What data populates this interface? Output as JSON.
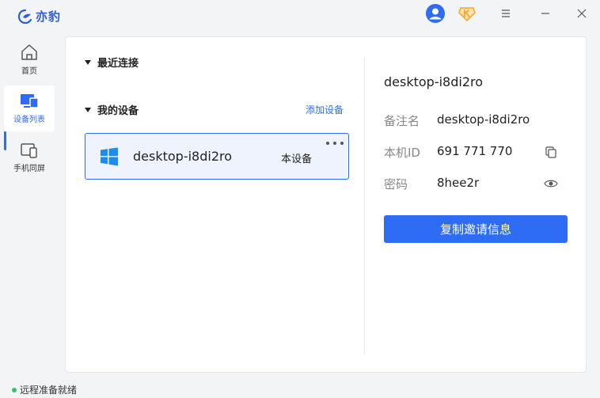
{
  "app": {
    "name": "亦豹"
  },
  "titlebar": {
    "icons": [
      "user-avatar-icon",
      "vip-badge-icon",
      "menu-icon",
      "minimize-icon",
      "close-icon"
    ]
  },
  "sidebar": {
    "items": [
      {
        "label": "首页",
        "icon": "home-icon"
      },
      {
        "label": "设备列表",
        "icon": "devices-icon",
        "active": true
      },
      {
        "label": "手机同屏",
        "icon": "phone-mirror-icon"
      }
    ]
  },
  "main": {
    "recent_label": "最近连接",
    "my_devices_label": "我的设备",
    "add_device_label": "添加设备",
    "device": {
      "name": "desktop-i8di2ro",
      "tag": "本设备",
      "icon": "windows-icon"
    }
  },
  "detail": {
    "title": "desktop-i8di2ro",
    "rows": [
      {
        "label": "备注名",
        "value": "desktop-i8di2ro"
      },
      {
        "label": "本机ID",
        "value": "691 771 770",
        "icon": "copy-icon"
      },
      {
        "label": "密码",
        "value": "8hee2r",
        "icon": "eye-icon"
      }
    ],
    "copy_button_label": "复制邀请信息"
  },
  "status": {
    "text": "远程准备就绪",
    "color": "#2ec46b"
  },
  "colors": {
    "accent": "#2f6cf5",
    "card_bg": "#eef3fd",
    "vip": "#f5a623"
  }
}
